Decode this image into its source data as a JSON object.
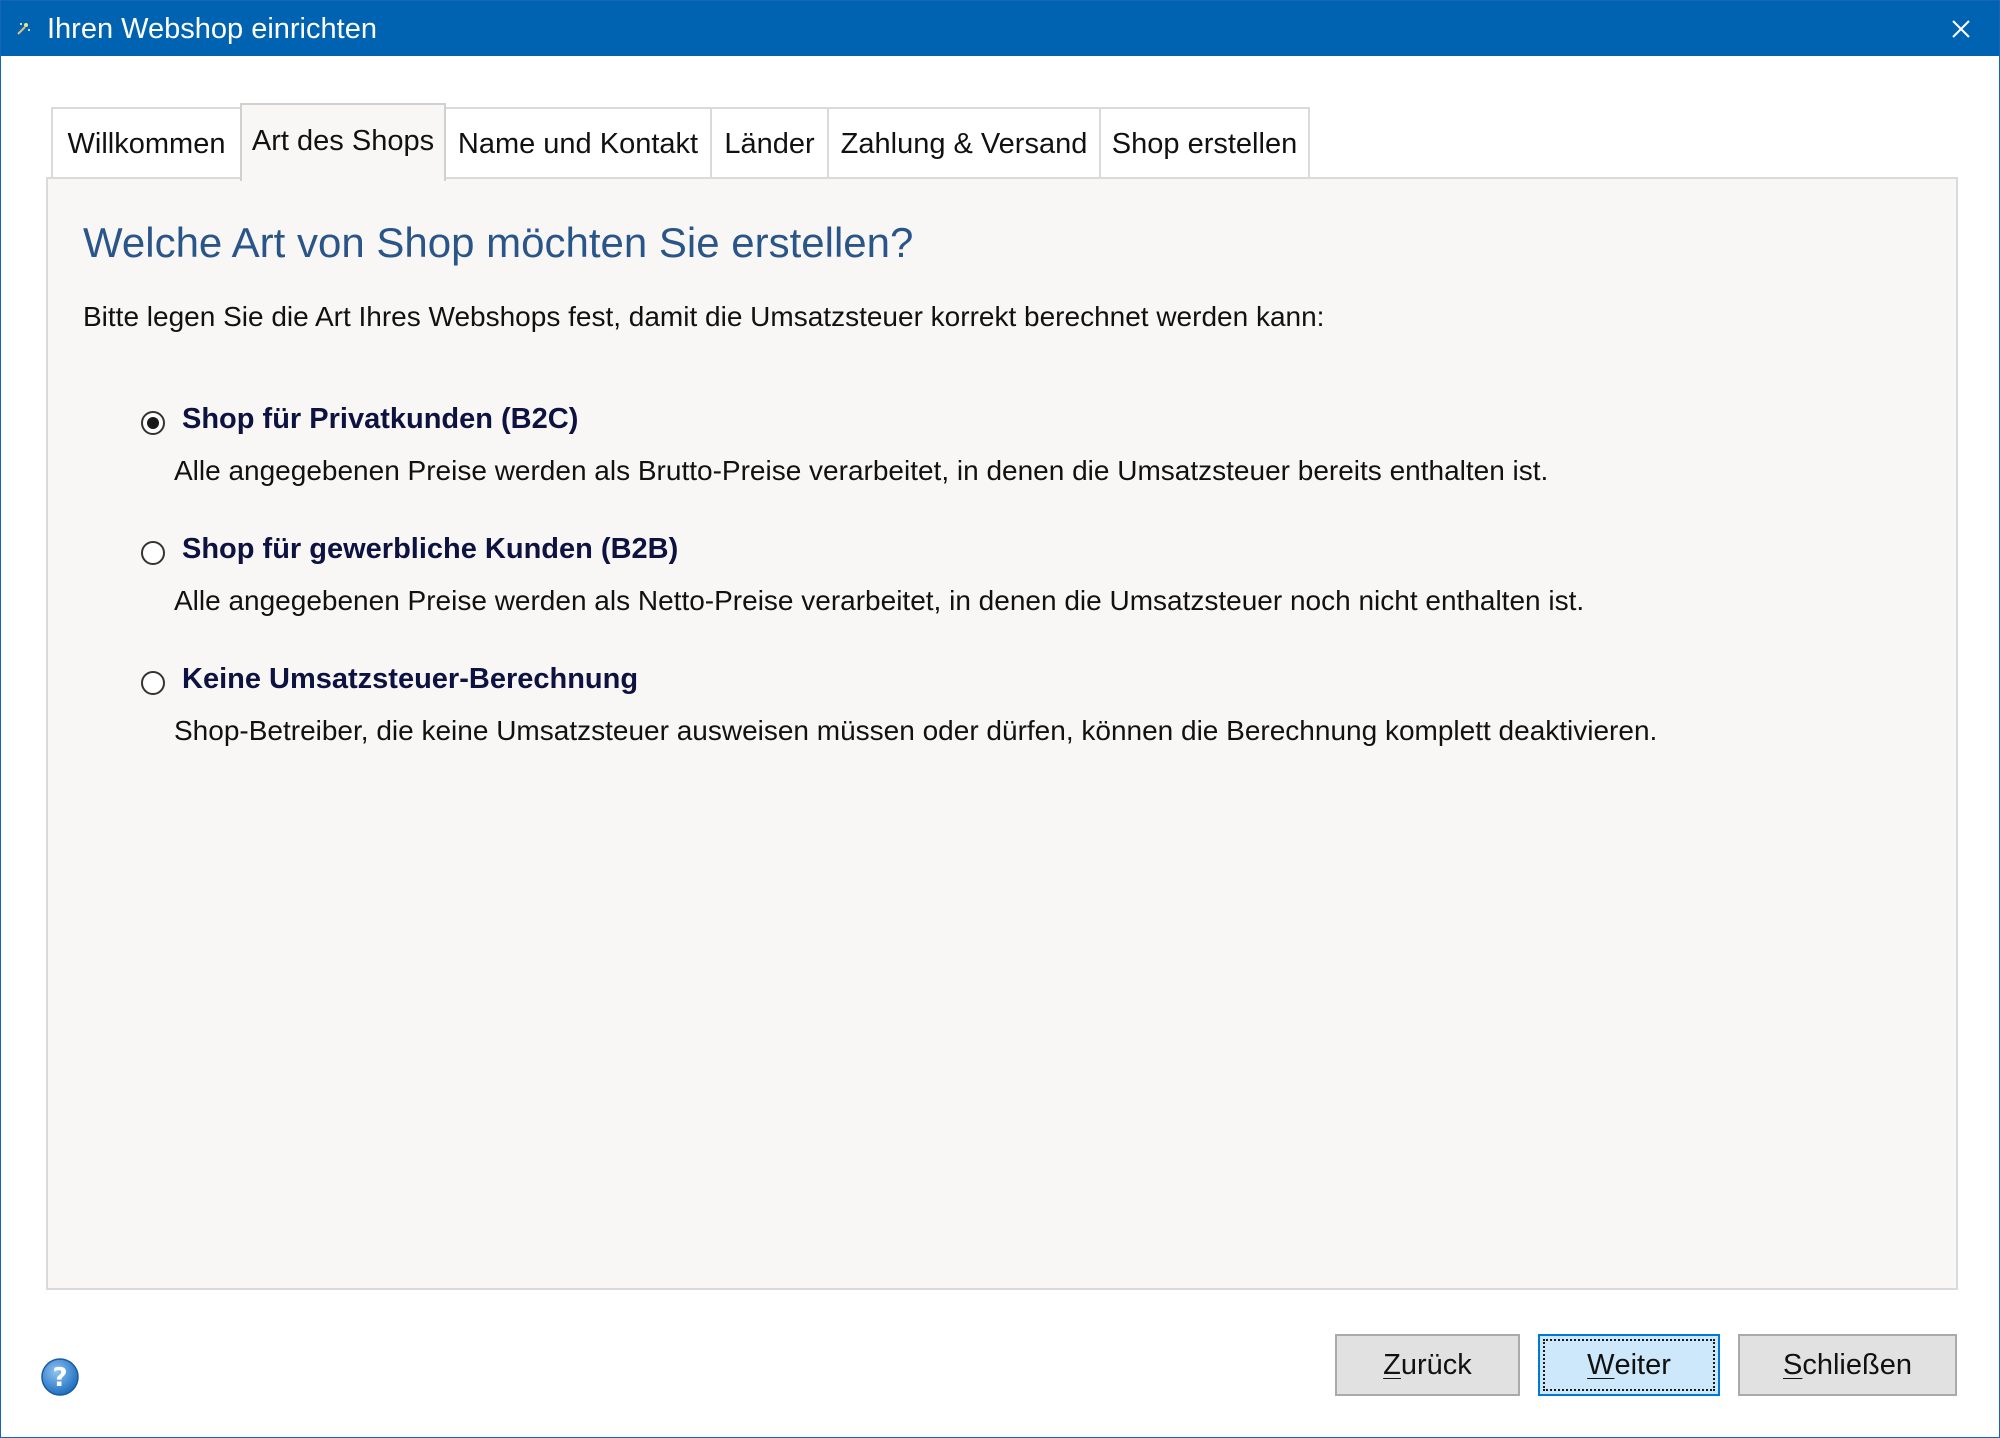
{
  "window": {
    "title": "Ihren Webshop einrichten",
    "accent_color": "#0063b1"
  },
  "tabs": [
    {
      "label": "Willkommen",
      "active": false
    },
    {
      "label": "Art des Shops",
      "active": true
    },
    {
      "label": "Name und Kontakt",
      "active": false
    },
    {
      "label": "Länder",
      "active": false
    },
    {
      "label": "Zahlung & Versand",
      "active": false
    },
    {
      "label": "Shop erstellen",
      "active": false
    }
  ],
  "panel": {
    "heading": "Welche Art von Shop möchten Sie erstellen?",
    "intro": "Bitte legen Sie die Art Ihres Webshops fest, damit die Umsatzsteuer korrekt berechnet werden kann:",
    "options": [
      {
        "label": "Shop für Privatkunden (B2C)",
        "description": "Alle angegebenen Preise werden als Brutto-Preise verarbeitet, in denen die Umsatzsteuer bereits enthalten ist.",
        "selected": true
      },
      {
        "label": "Shop für gewerbliche Kunden (B2B)",
        "description": "Alle angegebenen Preise werden als Netto-Preise verarbeitet, in denen die Umsatzsteuer noch nicht enthalten ist.",
        "selected": false
      },
      {
        "label": "Keine Umsatzsteuer-Berechnung",
        "description": "Shop-Betreiber, die keine Umsatzsteuer ausweisen müssen oder dürfen, können die Berechnung komplett deaktivieren.",
        "selected": false
      }
    ]
  },
  "footer": {
    "help_icon": "help-icon",
    "back": {
      "first": "Z",
      "rest": "urück"
    },
    "next": {
      "first": "W",
      "rest": "eiter"
    },
    "close": {
      "first": "S",
      "rest": "chließen"
    }
  }
}
